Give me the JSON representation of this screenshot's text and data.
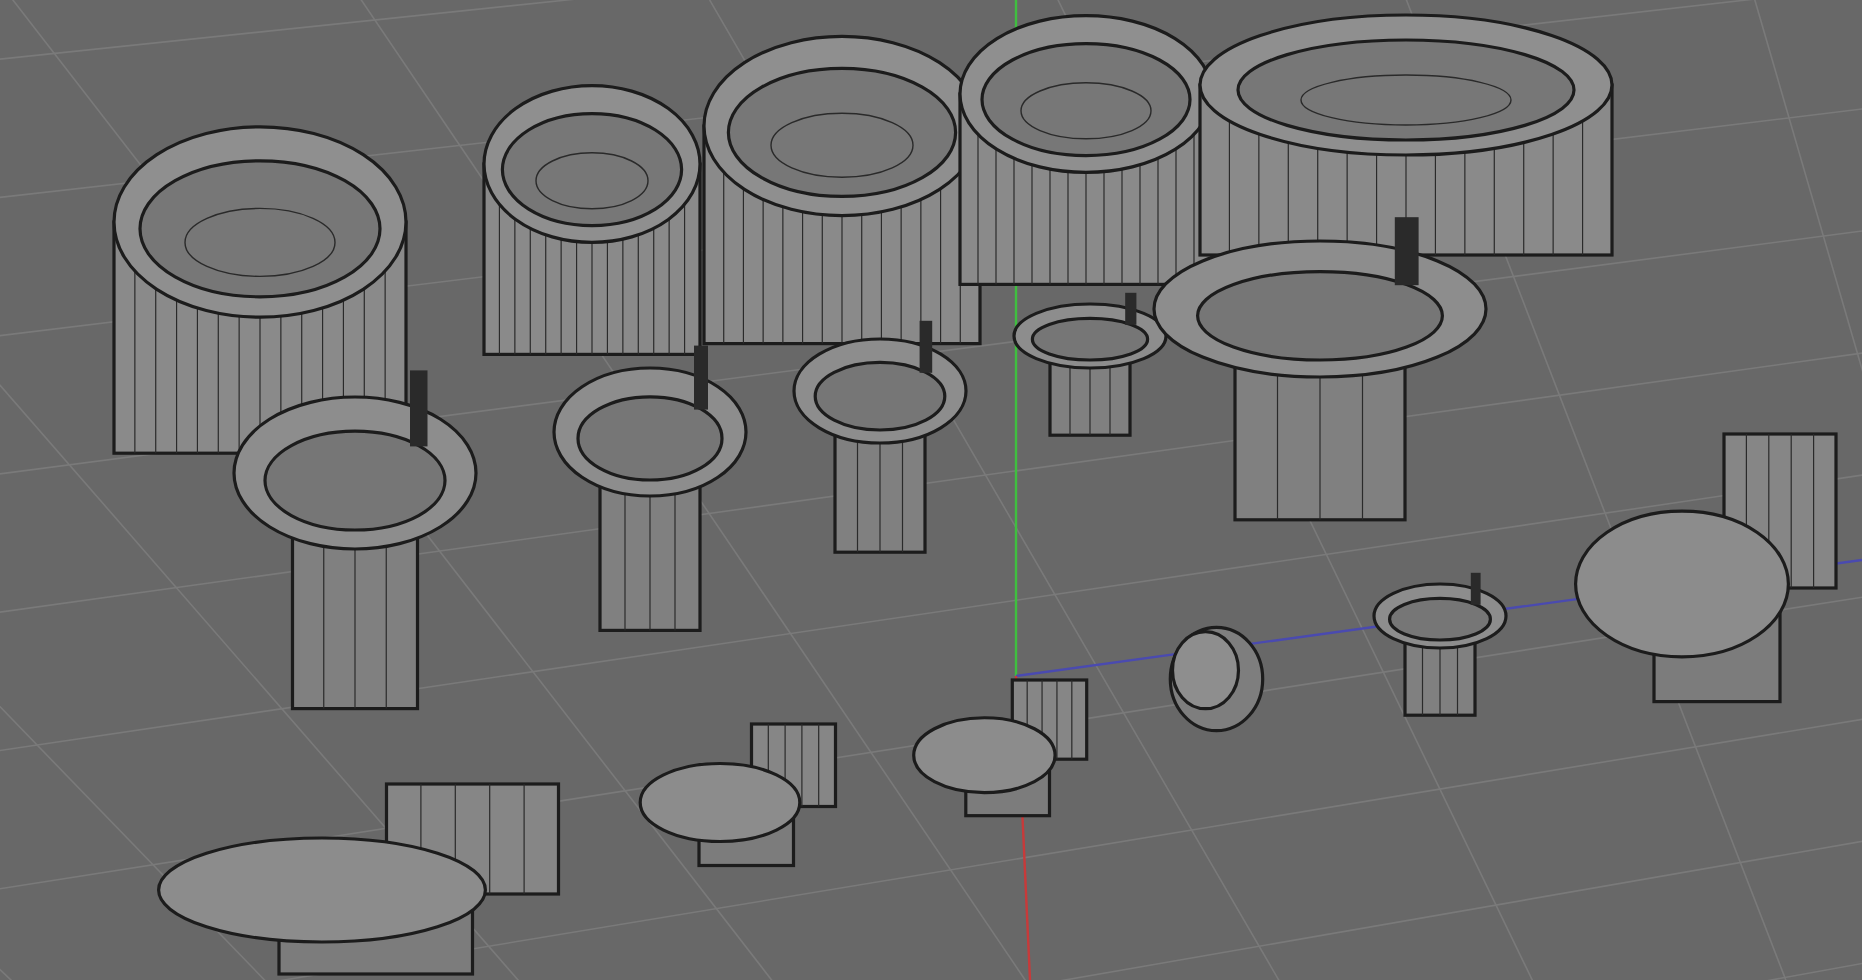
{
  "viewport": {
    "objects": [
      {
        "kind": "bathtub"
      },
      {
        "kind": "bathtub"
      },
      {
        "kind": "bathtub"
      },
      {
        "kind": "bathtub"
      },
      {
        "kind": "bathtub"
      },
      {
        "kind": "sink"
      },
      {
        "kind": "sink"
      },
      {
        "kind": "sink"
      },
      {
        "kind": "sink"
      },
      {
        "kind": "sink"
      },
      {
        "kind": "toilet"
      },
      {
        "kind": "sink"
      },
      {
        "kind": "urinal"
      },
      {
        "kind": "toilet"
      },
      {
        "kind": "toilet"
      },
      {
        "kind": "toilet"
      }
    ]
  }
}
